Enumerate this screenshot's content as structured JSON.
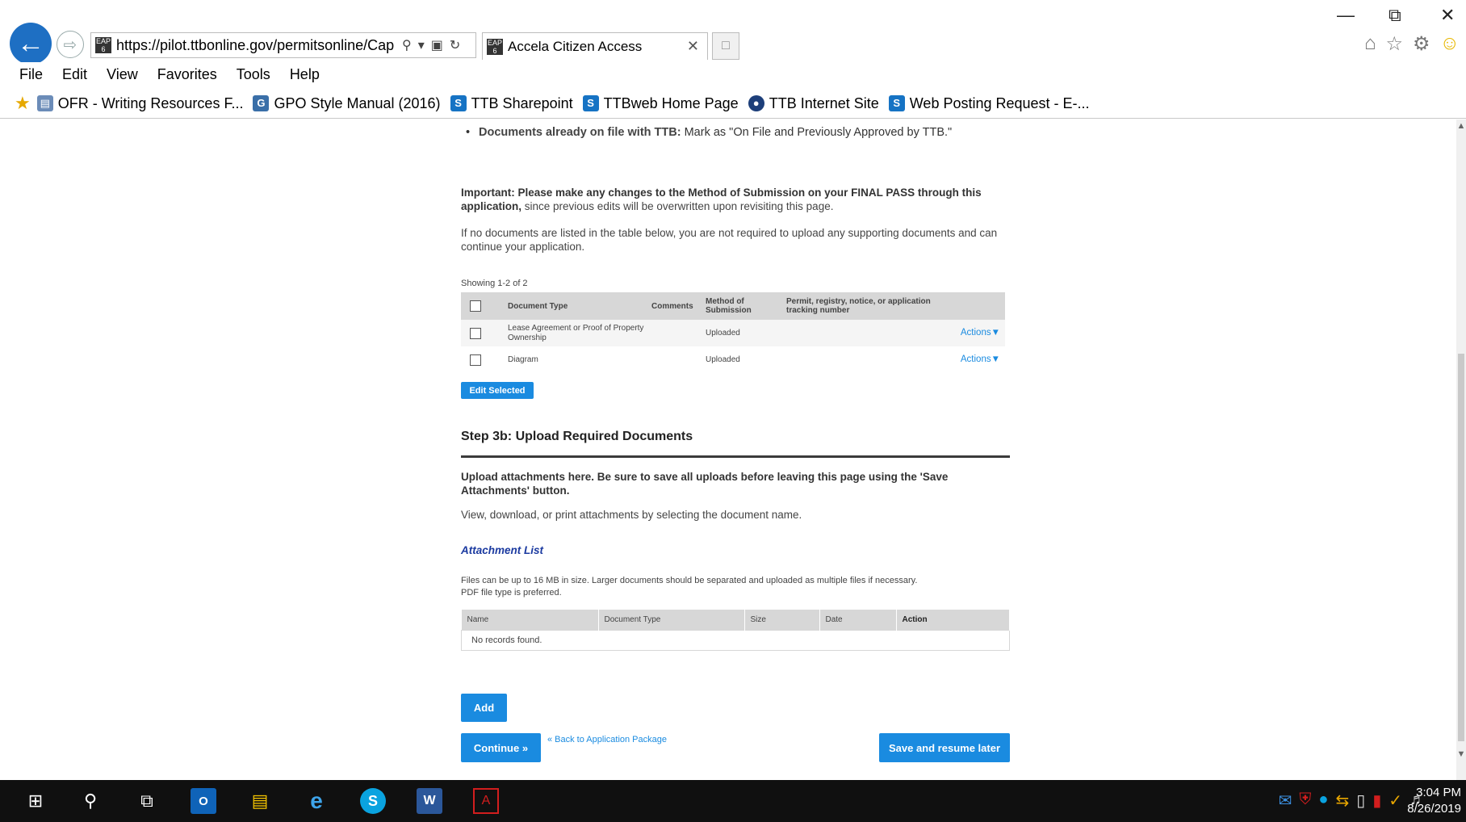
{
  "browser": {
    "address_url": "https://pilot.ttbonline.gov/permitsonline/Cap",
    "tab_title": "Accela Citizen Access",
    "menu": [
      "File",
      "Edit",
      "View",
      "Favorites",
      "Tools",
      "Help"
    ],
    "favorites": [
      {
        "label": "OFR - Writing Resources F...",
        "icon": "document-icon"
      },
      {
        "label": "GPO Style Manual (2016)",
        "icon": "gpo-icon"
      },
      {
        "label": "TTB Sharepoint",
        "icon": "sharepoint-icon"
      },
      {
        "label": "TTBweb Home Page",
        "icon": "sharepoint-icon"
      },
      {
        "label": "TTB Internet Site",
        "icon": "ttb-seal-icon"
      },
      {
        "label": "Web Posting Request - E-...",
        "icon": "sharepoint-icon"
      }
    ]
  },
  "page": {
    "bullet_bold": "Documents already on file with TTB:",
    "bullet_rest": " Mark as \"On File and Previously Approved by TTB.\"",
    "important_bold": "Important: Please make any changes to the Method of Submission on your FINAL PASS through this application,",
    "important_rest": " since previous edits will be overwritten upon revisiting this page.",
    "no_docs_text": "If no documents are listed in the table below, you are not required to upload any supporting documents and can continue your application.",
    "showing_text": "Showing 1-2 of 2",
    "doc_table": {
      "headers": [
        "Document Type",
        "Comments",
        "Method of Submission",
        "Permit, registry, notice, or application tracking number"
      ],
      "rows": [
        {
          "document_type": "Lease Agreement or Proof of Property Ownership",
          "comments": "",
          "method": "Uploaded",
          "tracking": "",
          "action": "Actions"
        },
        {
          "document_type": "Diagram",
          "comments": "",
          "method": "Uploaded",
          "tracking": "",
          "action": "Actions"
        }
      ]
    },
    "edit_selected_label": "Edit Selected",
    "step_title": "Step 3b: Upload Required Documents",
    "upload_bold": "Upload attachments here. Be sure to save all uploads before leaving this page using the 'Save Attachments' button.",
    "view_text": "View, download, or print attachments by selecting the document name.",
    "attachment_list_title": "Attachment List",
    "file_note_1": "Files can be up to 16 MB in size. Larger documents should be separated and uploaded as multiple files if necessary.",
    "file_note_2": "PDF file type is preferred.",
    "attach_table": {
      "headers": [
        "Name",
        "Document Type",
        "Size",
        "Date",
        "Action"
      ],
      "empty_text": "No records found."
    },
    "add_label": "Add",
    "continue_label": "Continue »",
    "back_link_label": "« Back to Application Package",
    "save_resume_label": "Save and resume later"
  },
  "taskbar": {
    "time": "3:04 PM",
    "date": "8/26/2019"
  }
}
